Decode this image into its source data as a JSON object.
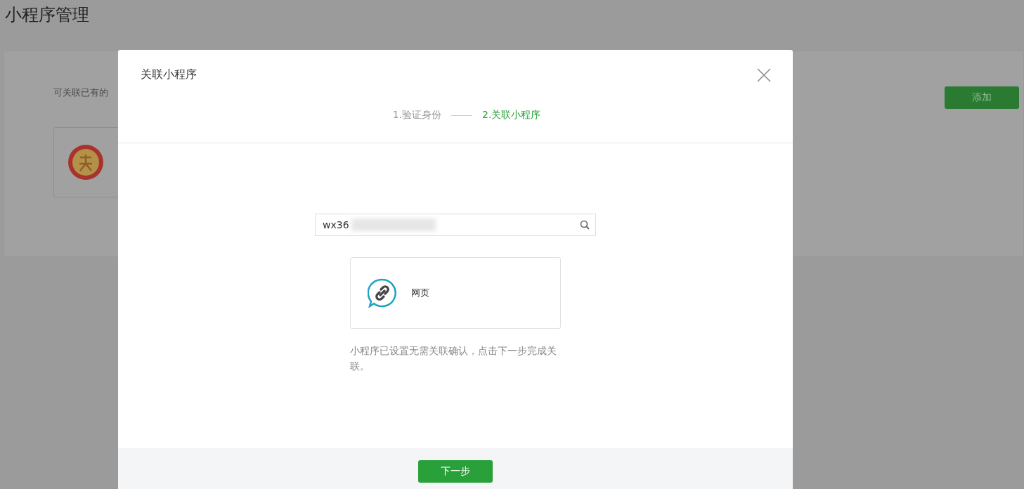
{
  "page": {
    "title": "小程序管理",
    "intro": "可关联已有的",
    "add_button": "添加"
  },
  "dialog": {
    "title": "关联小程序",
    "steps": [
      {
        "label": "1.验证身份",
        "selected": false
      },
      {
        "label": "2.关联小程序",
        "selected": true
      }
    ],
    "search": {
      "value": "wx36"
    },
    "result": {
      "name": "网页"
    },
    "note": "小程序已设置无需关联确认，点击下一步完成关联。",
    "next_button": "下一步"
  }
}
